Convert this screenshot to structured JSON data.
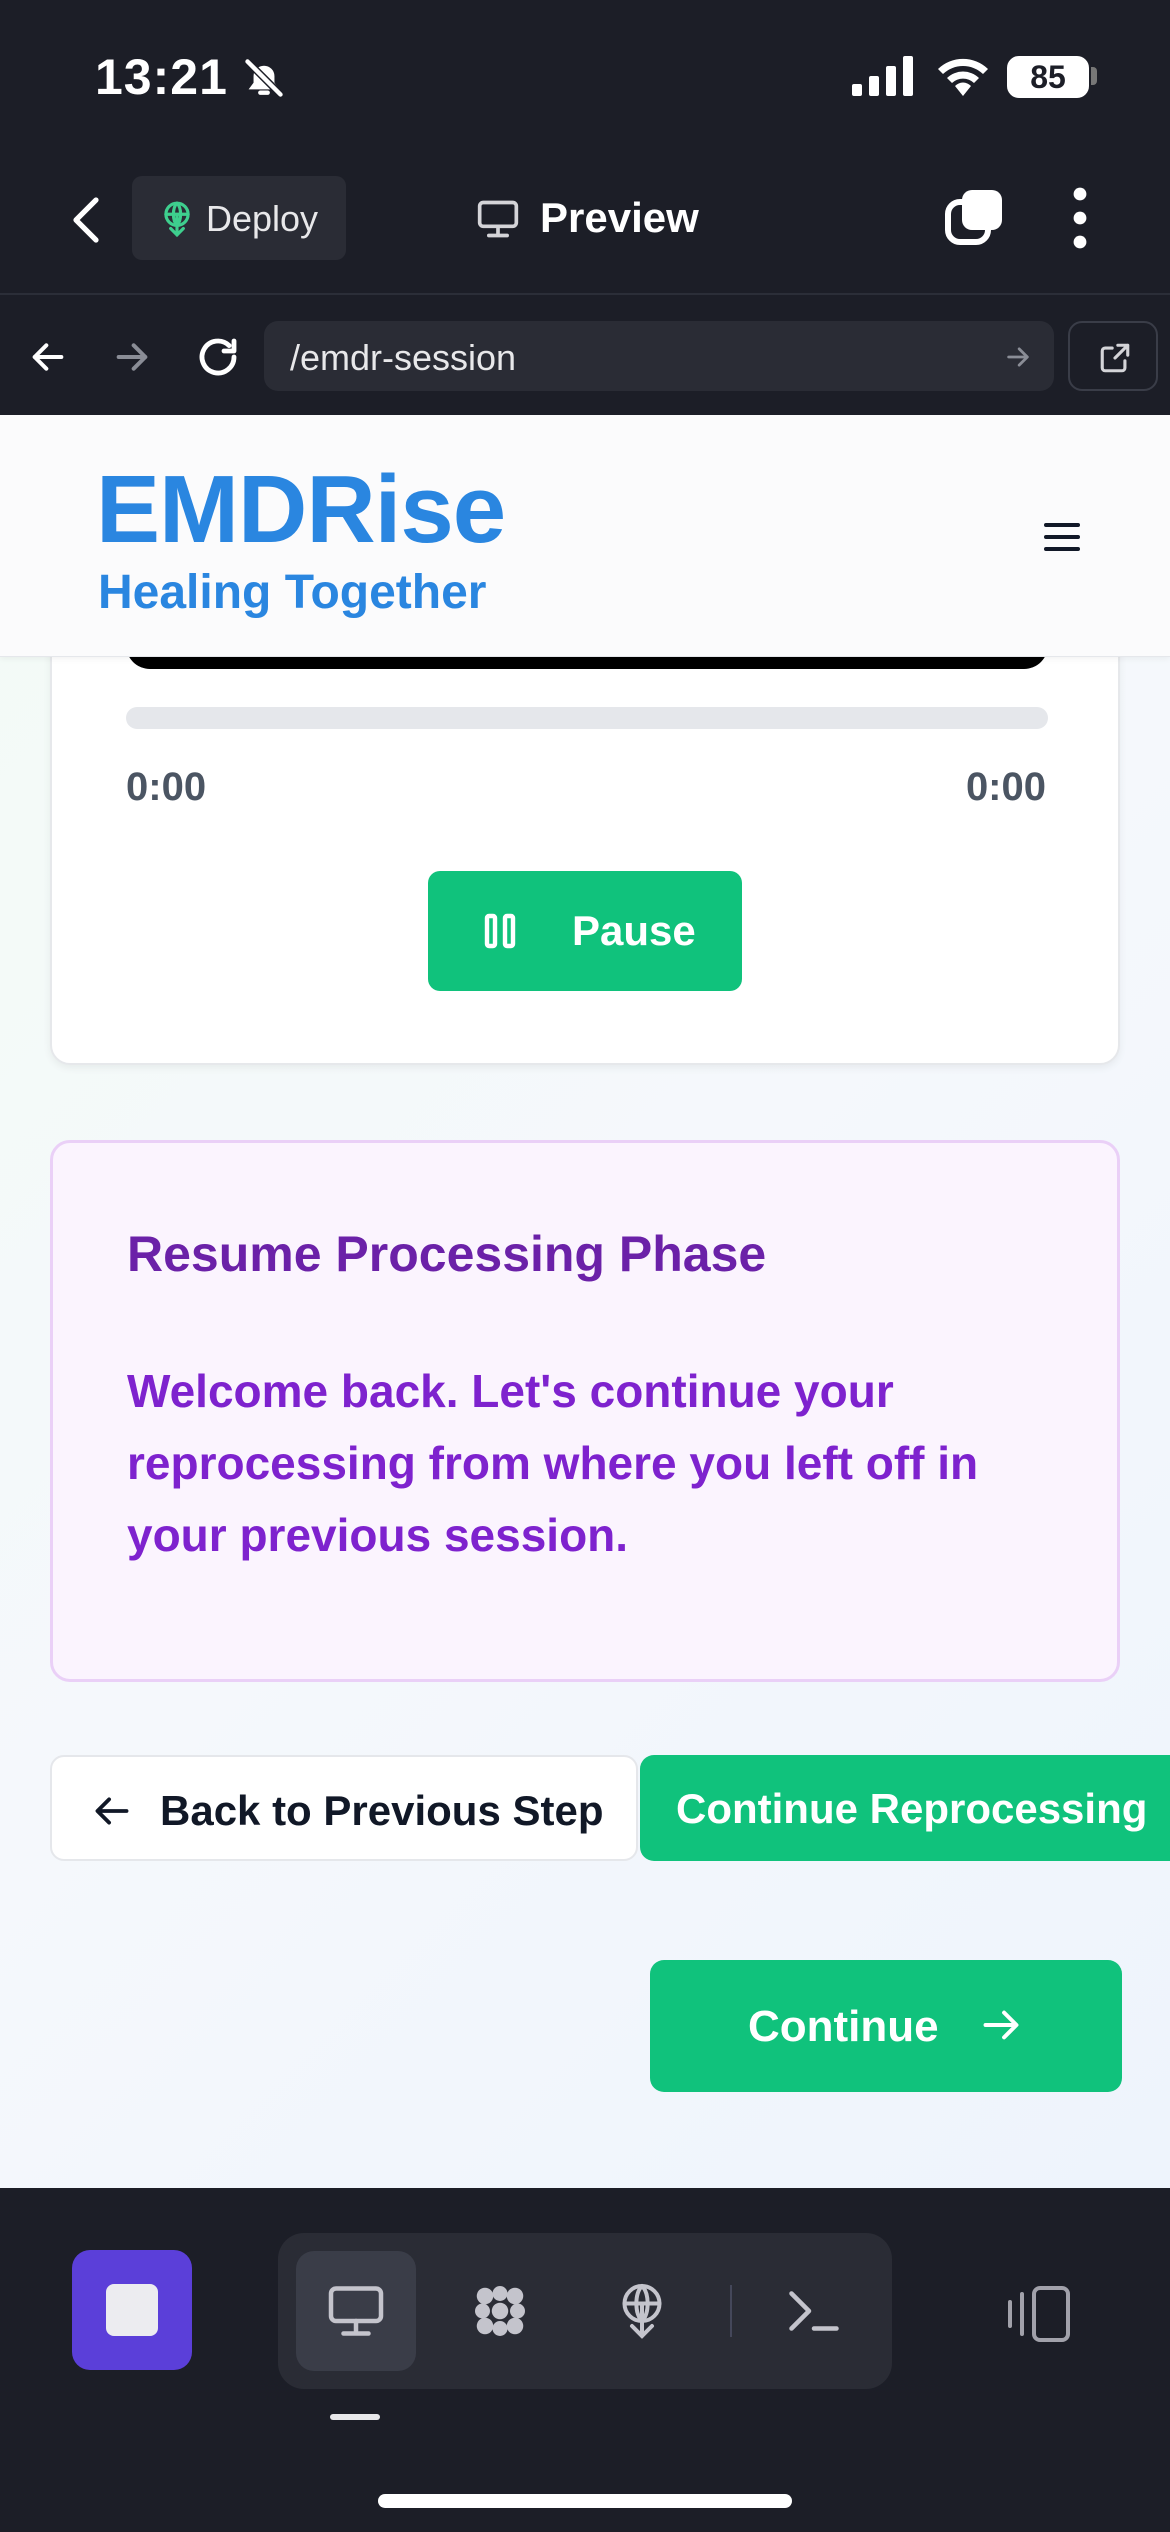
{
  "status_bar": {
    "time": "13:21",
    "battery": "85",
    "icons": [
      "bell-off-icon",
      "signal-icon",
      "wifi-icon",
      "battery-icon"
    ]
  },
  "app_bar": {
    "deploy_label": "Deploy",
    "preview_label": "Preview",
    "icons": [
      "back-chevron-icon",
      "deploy-icon",
      "monitor-icon",
      "tabs-icon",
      "more-vertical-icon"
    ]
  },
  "url_bar": {
    "url": "/emdr-session",
    "icons": [
      "arrow-left-icon",
      "arrow-right-icon",
      "reload-icon",
      "arrow-right-icon",
      "open-external-icon"
    ]
  },
  "site": {
    "brand": "EMDRise",
    "tagline": "Healing Together",
    "menu_icon": "hamburger-icon"
  },
  "player": {
    "current_time": "0:00",
    "duration": "0:00",
    "progress_fraction": 0,
    "pause_label": "Pause",
    "pause_icon": "pause-icon"
  },
  "resume": {
    "title": "Resume Processing Phase",
    "body": "Welcome back. Let's continue your reprocessing from where you left off in your previous session."
  },
  "actions": {
    "back_label": "Back to Previous Step",
    "continue_reprocessing_label": "Continue Reprocessing",
    "continue_label": "Continue"
  },
  "bottom_bar": {
    "tools": [
      "monitor-icon",
      "integrations-icon",
      "deploy-icon",
      "terminal-icon"
    ],
    "active_tool": "monitor-icon",
    "device_toggle_icon": "device-toggle-icon"
  },
  "colors": {
    "brand_blue": "#2a86e0",
    "accent_green": "#10c27c",
    "purple_title": "#6b21a8",
    "purple_body": "#7e22ce",
    "stop_purple": "#5b3fd9",
    "chrome_dark": "#1c1e27"
  }
}
